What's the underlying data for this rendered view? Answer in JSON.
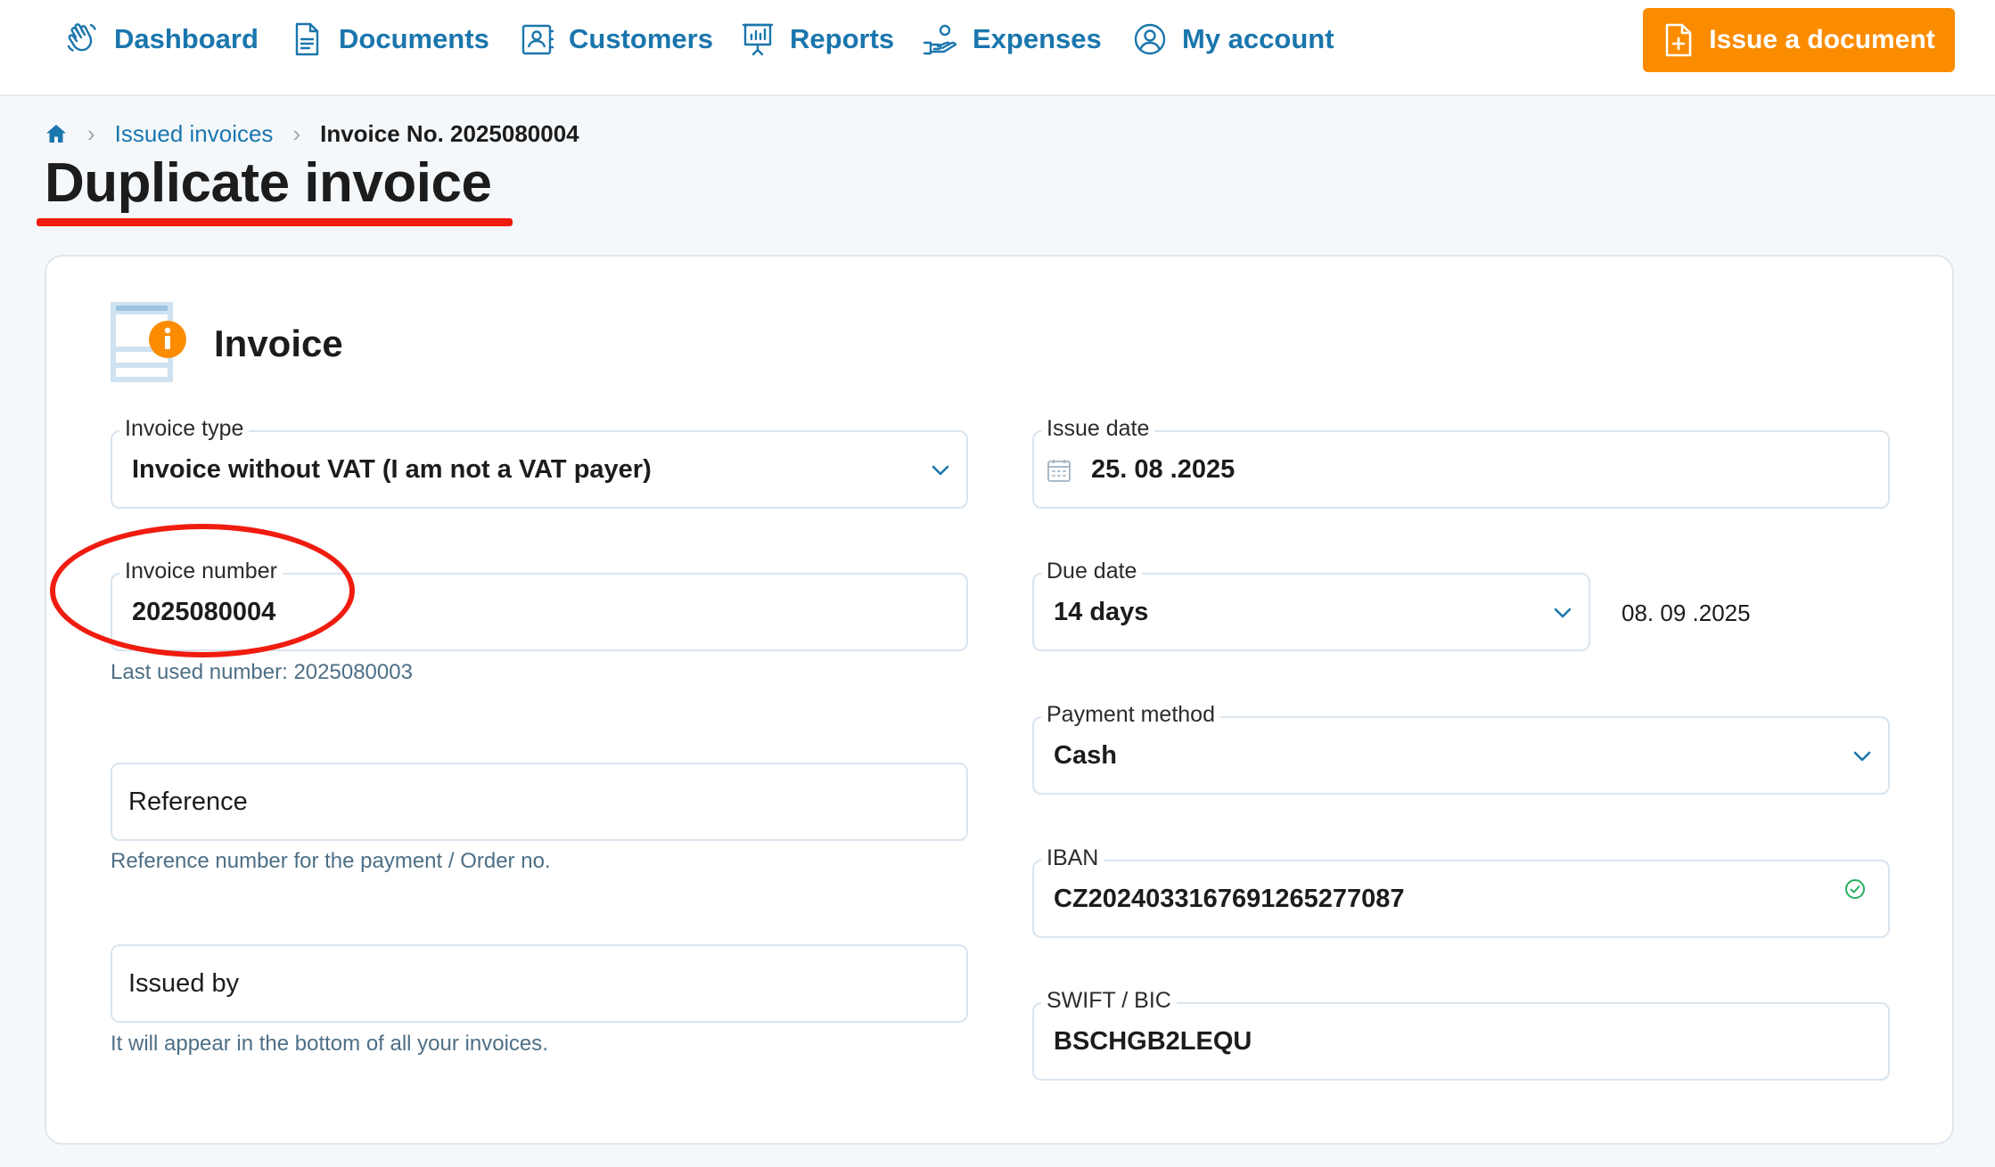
{
  "nav": {
    "items": [
      {
        "label": "Dashboard",
        "icon": "hand-wave-icon"
      },
      {
        "label": "Documents",
        "icon": "document-icon"
      },
      {
        "label": "Customers",
        "icon": "contacts-icon"
      },
      {
        "label": "Reports",
        "icon": "presentation-chart-icon"
      },
      {
        "label": "Expenses",
        "icon": "hand-coins-icon"
      },
      {
        "label": "My account",
        "icon": "user-circle-icon"
      }
    ],
    "issue_button": "Issue a document"
  },
  "breadcrumb": {
    "link": "Issued invoices",
    "current": "Invoice No. 2025080004"
  },
  "page_title": "Duplicate invoice",
  "card": {
    "title": "Invoice",
    "invoice_type": {
      "label": "Invoice type",
      "value": "Invoice without VAT (I am not a VAT payer)"
    },
    "invoice_number": {
      "label": "Invoice number",
      "value": "2025080004",
      "hint": "Last used number: 2025080003"
    },
    "reference": {
      "placeholder": "Reference",
      "hint": "Reference number for the payment / Order no."
    },
    "issued_by": {
      "placeholder": "Issued by",
      "hint": "It will appear in the bottom of all your invoices."
    },
    "issue_date": {
      "label": "Issue date",
      "value": "25. 08 .2025"
    },
    "due_date": {
      "label": "Due date",
      "value": "14 days",
      "computed": "08. 09 .2025"
    },
    "payment_method": {
      "label": "Payment method",
      "value": "Cash"
    },
    "iban": {
      "label": "IBAN",
      "value": "CZ2024033167691265277087"
    },
    "swift": {
      "label": "SWIFT / BIC",
      "value": "BSCHGB2LEQU"
    }
  },
  "colors": {
    "accent": "#1a76ad",
    "button": "#fb8c00",
    "annotation": "#f01c10",
    "success": "#27ae60"
  }
}
